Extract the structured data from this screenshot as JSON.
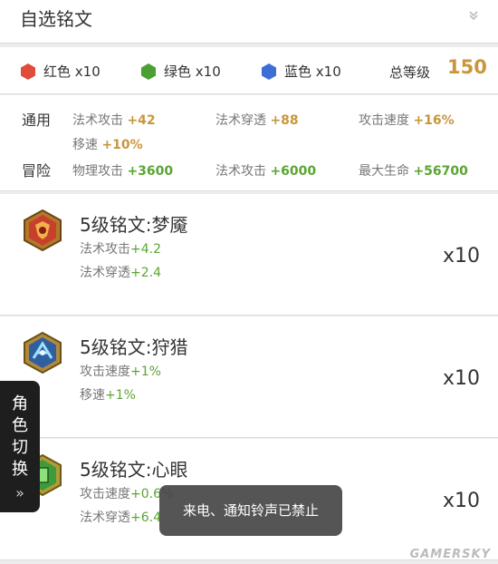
{
  "header": {
    "title": "自选铭文"
  },
  "summary": {
    "gems": [
      {
        "label": "红色 x10",
        "color": "#e04c3c"
      },
      {
        "label": "绿色 x10",
        "color": "#4aa034"
      },
      {
        "label": "蓝色 x10",
        "color": "#3d6ed6"
      }
    ],
    "total_label": "总等级",
    "total_value": "150"
  },
  "stats": {
    "general_label": "通用",
    "general": [
      {
        "name": "法术攻击",
        "value": "+42"
      },
      {
        "name": "法术穿透",
        "value": "+88"
      },
      {
        "name": "攻击速度",
        "value": "+16%"
      },
      {
        "name": "移速",
        "value": "+10%"
      }
    ],
    "adventure_label": "冒险",
    "adventure": [
      {
        "name": "物理攻击",
        "value": "+3600"
      },
      {
        "name": "法术攻击",
        "value": "+6000"
      },
      {
        "name": "最大生命",
        "value": "+56700"
      }
    ]
  },
  "runes": [
    {
      "name": "5级铭文:梦魇",
      "lines": [
        {
          "name": "法术攻击",
          "value": "+4.2"
        },
        {
          "name": "法术穿透",
          "value": "+2.4"
        }
      ],
      "count": "x10",
      "color": "#c8402c"
    },
    {
      "name": "5级铭文:狩猎",
      "lines": [
        {
          "name": "攻击速度",
          "value": "+1%"
        },
        {
          "name": "移速",
          "value": "+1%"
        }
      ],
      "count": "x10",
      "color": "#3a7fc8"
    },
    {
      "name": "5级铭文:心眼",
      "lines": [
        {
          "name": "攻击速度",
          "value": "+0.6%"
        },
        {
          "name": "法术穿透",
          "value": "+6.4"
        }
      ],
      "count": "x10",
      "color": "#3f9a3a"
    }
  ],
  "side_tab": {
    "label": "角色切换",
    "arrows": "»"
  },
  "toast": {
    "text": "来电、通知铃声已禁止"
  },
  "watermark": "GAMERSKY"
}
